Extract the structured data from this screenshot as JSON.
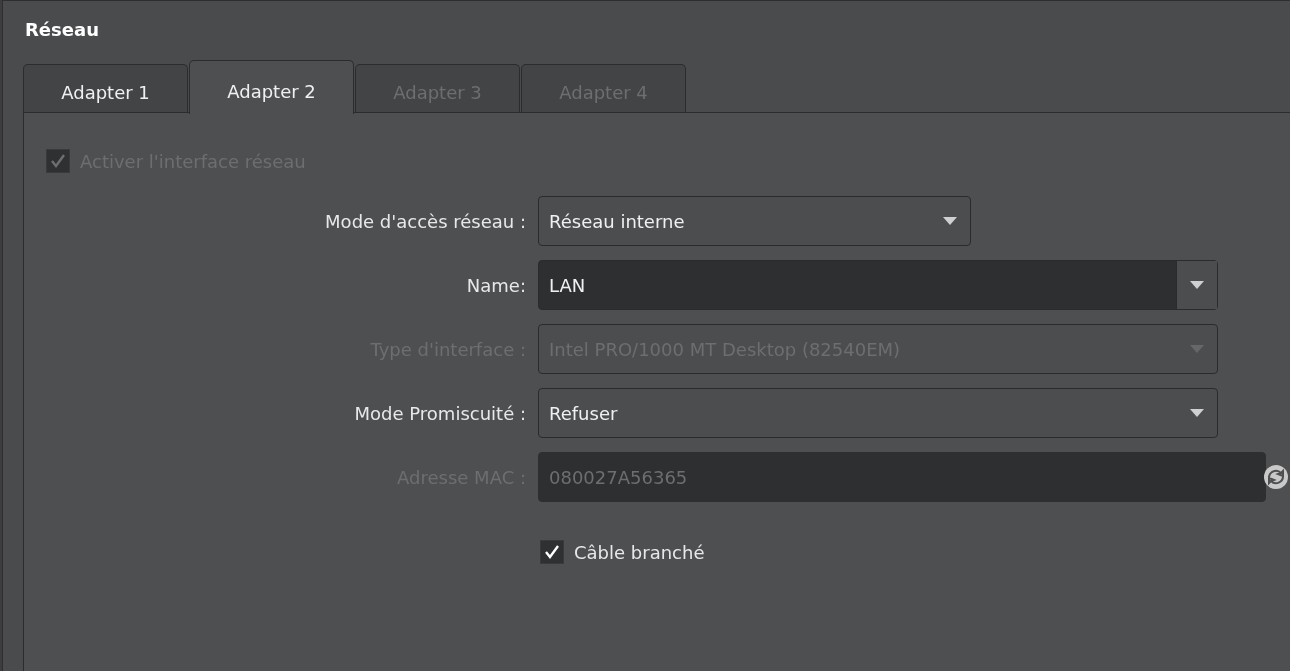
{
  "section": {
    "title": "Réseau"
  },
  "tabs": [
    {
      "label": "Adapter 1",
      "selected": false,
      "disabled": false
    },
    {
      "label": "Adapter 2",
      "selected": true,
      "disabled": false
    },
    {
      "label": "Adapter 3",
      "selected": false,
      "disabled": true
    },
    {
      "label": "Adapter 4",
      "selected": false,
      "disabled": true
    }
  ],
  "enable_checkbox": {
    "label": "Activer l'interface réseau",
    "checked": true,
    "disabled": true
  },
  "fields": [
    {
      "kind": "combo",
      "label": "Mode d'accès réseau :",
      "value": "Réseau interne",
      "disabled": false,
      "wide": false
    },
    {
      "kind": "editable",
      "label": "Name:",
      "value": "LAN",
      "disabled": false,
      "wide": true
    },
    {
      "kind": "combo",
      "label": "Type d'interface :",
      "value": "Intel PRO/1000 MT Desktop (82540EM)",
      "disabled": true,
      "wide": true
    },
    {
      "kind": "combo",
      "label": "Mode Promiscuité :",
      "value": "Refuser",
      "disabled": false,
      "wide": true
    },
    {
      "kind": "text",
      "label": "Adresse MAC :",
      "value": "080027A56365",
      "disabled": true,
      "wide": true
    }
  ],
  "cable_checkbox": {
    "label": "Câble branché",
    "checked": true,
    "disabled": false
  }
}
